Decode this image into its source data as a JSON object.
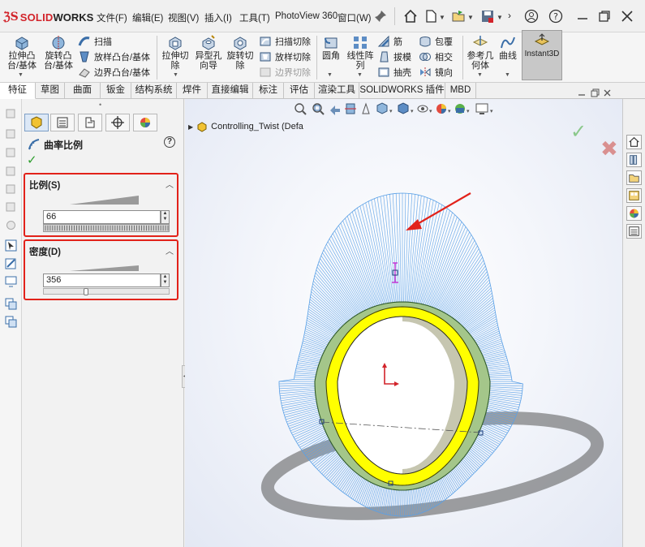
{
  "menubar": {
    "logo_ds": "ℨS",
    "logo_solid": "SOLID",
    "logo_works": "WORKS",
    "items": [
      "文件(F)",
      "编辑(E)",
      "视图(V)",
      "插入(I)",
      "工具(T)",
      "PhotoView 360",
      "窗口(W)"
    ],
    "overflow": "›",
    "qa_icons": [
      "home-icon",
      "new-document-icon",
      "open-icon",
      "save-icon",
      "print-icon",
      "user-icon",
      "help-icon",
      "minimize-icon",
      "close-icon"
    ]
  },
  "command_manager": {
    "extrude_boss": "拉伸凸\n台/基体",
    "revolve_boss": "旋转凸\n台/基体",
    "sweep": "扫描",
    "loft_boss": "放样凸台/基体",
    "boundary_boss": "边界凸台/基体",
    "extrude_cut": "拉伸切\n除",
    "hole_wizard": "异型孔\n向导",
    "revolve_cut": "旋转切\n除",
    "swept_cut": "扫描切除",
    "lofted_cut": "放样切除",
    "boundary_cut": "边界切除",
    "fillet": "圆角",
    "linear_pattern": "线性阵\n列",
    "rib": "筋",
    "draft": "拔模",
    "shell": "抽壳",
    "wrap": "包覆",
    "intersect": "相交",
    "mirror": "镜向",
    "ref_geometry": "参考几\n何体",
    "curves": "曲线",
    "instant3d": "Instant3D"
  },
  "tabs": [
    "特征",
    "草图",
    "曲面",
    "钣金",
    "结构系统",
    "焊件",
    "直接编辑",
    "标注",
    "评估",
    "渲染工具",
    "SOLIDWORKS 插件",
    "MBD"
  ],
  "active_tab": "特征",
  "property_manager": {
    "collapse_dot": "•",
    "title": "曲率比例",
    "ok_symbol": "✓",
    "help": "?",
    "scale_group": {
      "title": "比例(S)",
      "value": "66"
    },
    "density_group": {
      "title": "密度(D)",
      "value": "356",
      "slider_fraction": 0.33
    }
  },
  "viewport": {
    "tree_node": "Controlling_Twist  (Defa",
    "ok_symbol": "✓",
    "cancel_symbol": "✖"
  },
  "colors": {
    "accent_red": "#e2221a",
    "part_yellow": "#ffff00",
    "comb_blue": "#5aa0e6",
    "edge_green": "#6fa86b",
    "ok_green": "#2e9e2e"
  }
}
